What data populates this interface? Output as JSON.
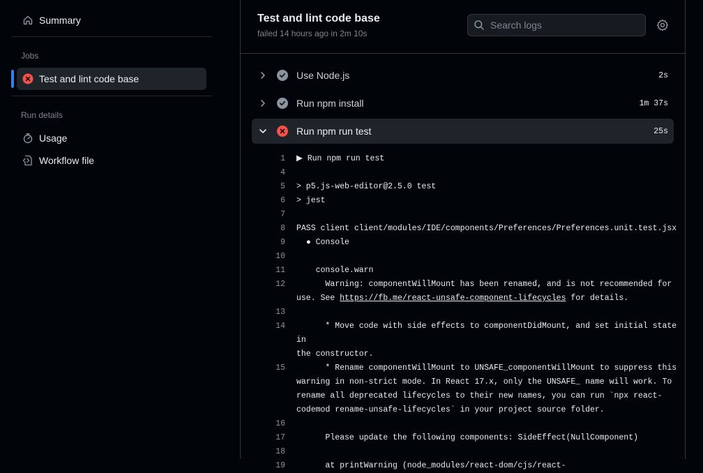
{
  "sidebar": {
    "summary_label": "Summary",
    "jobs_heading": "Jobs",
    "job_label": "Test and lint code base",
    "run_details_heading": "Run details",
    "usage_label": "Usage",
    "workflow_label": "Workflow file"
  },
  "header": {
    "title": "Test and lint code base",
    "status_text": "failed 14 hours ago in 2m 10s",
    "search_placeholder": "Search logs"
  },
  "steps": [
    {
      "name": "Use Node.js",
      "duration": "2s",
      "status": "success",
      "expanded": false
    },
    {
      "name": "Run npm install",
      "duration": "1m 37s",
      "status": "success",
      "expanded": false
    },
    {
      "name": "Run npm run test",
      "duration": "25s",
      "status": "failure",
      "expanded": true
    }
  ],
  "log_lines": [
    {
      "n": "1",
      "t": "▶ Run npm run test"
    },
    {
      "n": "4",
      "t": ""
    },
    {
      "n": "5",
      "t": "> p5.js-web-editor@2.5.0 test"
    },
    {
      "n": "6",
      "t": "> jest"
    },
    {
      "n": "7",
      "t": ""
    },
    {
      "n": "8",
      "t": "PASS client client/modules/IDE/components/Preferences/Preferences.unit.test.jsx"
    },
    {
      "n": "9",
      "t": "  ● Console"
    },
    {
      "n": "10",
      "t": ""
    },
    {
      "n": "11",
      "t": "    console.warn"
    },
    {
      "n": "12",
      "t": "      Warning: componentWillMount has been renamed, and is not recommended for\nuse. See ",
      "link": "https://fb.me/react-unsafe-component-lifecycles",
      "after": " for details."
    },
    {
      "n": "13",
      "t": ""
    },
    {
      "n": "14",
      "t": "      * Move code with side effects to componentDidMount, and set initial state in\nthe constructor."
    },
    {
      "n": "15",
      "t": "      * Rename componentWillMount to UNSAFE_componentWillMount to suppress this\nwarning in non-strict mode. In React 17.x, only the UNSAFE_ name will work. To\nrename all deprecated lifecycles to their new names, you can run `npx react-\ncodemod rename-unsafe-lifecycles` in your project source folder."
    },
    {
      "n": "16",
      "t": ""
    },
    {
      "n": "17",
      "t": "      Please update the following components: SideEffect(NullComponent)"
    },
    {
      "n": "18",
      "t": ""
    },
    {
      "n": "19",
      "t": "      at printWarning (node_modules/react-dom/cjs/react-"
    }
  ],
  "colors": {
    "accent": "#2f81f7",
    "failure": "#f85149",
    "success": "#8b949e"
  }
}
